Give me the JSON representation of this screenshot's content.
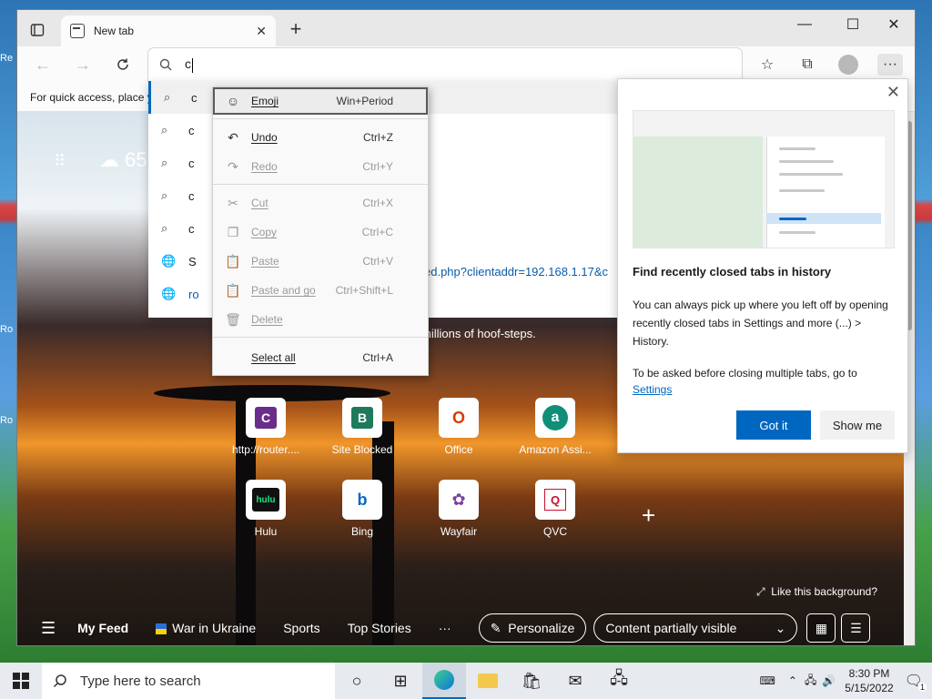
{
  "desktop": {
    "labels": [
      "Re",
      "Ro",
      "Ro"
    ]
  },
  "browser": {
    "tab": {
      "title": "New tab",
      "close": "✕"
    },
    "new_tab_symbol": "+",
    "window_controls": {
      "minimize": "—",
      "maximize": "☐",
      "close": "✕"
    },
    "address": {
      "value": "c"
    },
    "favorites_bar_text": "For quick access, place y"
  },
  "suggestions": [
    {
      "icon": "search-icon",
      "text": "c"
    },
    {
      "icon": "search-icon",
      "text": "c"
    },
    {
      "icon": "search-icon",
      "text": "c"
    },
    {
      "icon": "search-icon",
      "text": "c"
    },
    {
      "icon": "search-icon",
      "text": "c"
    },
    {
      "icon": "globe-icon",
      "text": "S"
    },
    {
      "icon": "globe-icon",
      "text": "ro"
    }
  ],
  "url_fragment": "cked.php?clientaddr=192.168.1.17&c",
  "context_menu": [
    {
      "label": "Emoji",
      "shortcut": "Win+Period",
      "disabled": false,
      "highlight": true,
      "icon": "☺"
    },
    {
      "label": "Undo",
      "shortcut": "Ctrl+Z",
      "disabled": false,
      "icon": "↶"
    },
    {
      "label": "Redo",
      "shortcut": "Ctrl+Y",
      "disabled": true,
      "icon": "↷"
    },
    {
      "label": "Cut",
      "shortcut": "Ctrl+X",
      "disabled": true,
      "icon": "✂"
    },
    {
      "label": "Copy",
      "shortcut": "Ctrl+C",
      "disabled": true,
      "icon": "❐"
    },
    {
      "label": "Paste",
      "shortcut": "Ctrl+V",
      "disabled": true,
      "icon": "📋"
    },
    {
      "label": "Paste and go",
      "shortcut": "Ctrl+Shift+L",
      "disabled": true,
      "icon": "📋"
    },
    {
      "label": "Delete",
      "shortcut": "",
      "disabled": true,
      "icon": "🗑"
    },
    {
      "label": "Select all",
      "shortcut": "Ctrl+A",
      "disabled": false,
      "icon": ""
    }
  ],
  "ntp": {
    "weather_temp": "65",
    "hoof_text": "millions of hoof-steps.",
    "tiles": [
      {
        "label": "http://router....",
        "icon": "C",
        "color": "#6b2d8c"
      },
      {
        "label": "Site Blocked",
        "icon": "B",
        "color": "#1f7a5c"
      },
      {
        "label": "Office",
        "icon": "O",
        "color": "#d83b01"
      },
      {
        "label": "Amazon Assi...",
        "icon": "a",
        "color": "#0f8f7a"
      },
      {
        "label": "Hulu",
        "icon": "hulu",
        "color": "#1ce783"
      },
      {
        "label": "Bing",
        "icon": "b",
        "color": "#0a66c2"
      },
      {
        "label": "Wayfair",
        "icon": "✿",
        "color": "#7b3fa0"
      },
      {
        "label": "QVC",
        "icon": "Q",
        "color": "#c8102e"
      }
    ],
    "add_tile": "+",
    "like_background": "Like this background?",
    "feed": {
      "my_feed": "My Feed",
      "war": "War in Ukraine",
      "sports": "Sports",
      "top_stories": "Top Stories",
      "more": "···",
      "personalize": "Personalize",
      "content": "Content partially visible"
    }
  },
  "tip": {
    "title": "Find recently closed tabs in history",
    "body1": "You can always pick up where you left off by opening recently closed tabs in Settings and more (...) > History.",
    "body2": "To be asked before closing multiple tabs, go to",
    "link": "Settings",
    "got_it": "Got it",
    "show_me": "Show me"
  },
  "taskbar": {
    "search_placeholder": "Type here to search",
    "time": "8:30 PM",
    "date": "5/15/2022",
    "notification_count": "1"
  },
  "colors": {
    "accent": "#0067c0"
  }
}
